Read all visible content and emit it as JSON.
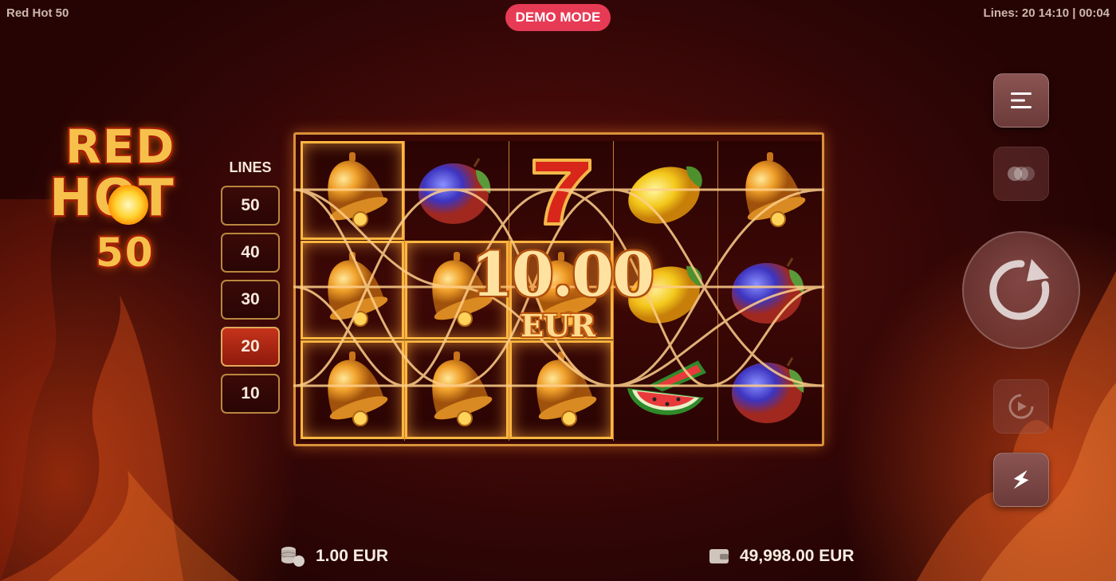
{
  "header": {
    "app_title": "Red Hot 50",
    "demo_badge": "DEMO MODE",
    "status": "Lines: 20  14:10 | 00:04"
  },
  "logo": {
    "line1": "RED",
    "line2": "HOT",
    "line3": "50"
  },
  "lines_selector": {
    "label": "LINES",
    "options": [
      "50",
      "40",
      "30",
      "20",
      "10"
    ],
    "selected": "20"
  },
  "reels": {
    "columns": [
      [
        "bell",
        "bell",
        "bell"
      ],
      [
        "plum",
        "bell",
        "bell"
      ],
      [
        "seven",
        "bell",
        "bell"
      ],
      [
        "lemon",
        "lemon",
        "watermelon"
      ],
      [
        "bell",
        "plum",
        "plum"
      ]
    ],
    "winning_cells": [
      [
        0,
        0
      ],
      [
        0,
        1
      ],
      [
        0,
        2
      ],
      [
        1,
        1
      ],
      [
        1,
        2
      ],
      [
        2,
        1
      ],
      [
        2,
        2
      ]
    ]
  },
  "win": {
    "amount": "10.00",
    "currency": "EUR"
  },
  "controls": {
    "menu_icon": "menu-icon",
    "turbo_icon": "turbo-icon",
    "spin_icon": "spin-icon",
    "autoplay_icon": "autoplay-icon",
    "quickspin_icon": "lightning-icon"
  },
  "bottom": {
    "bet": "1.00 EUR",
    "balance": "49,998.00 EUR"
  },
  "colors": {
    "demo_badge": "#e73a55",
    "reel_frame": "#d9913a",
    "selected_line": "#c5331b",
    "win_text": "#ffe2a0"
  }
}
